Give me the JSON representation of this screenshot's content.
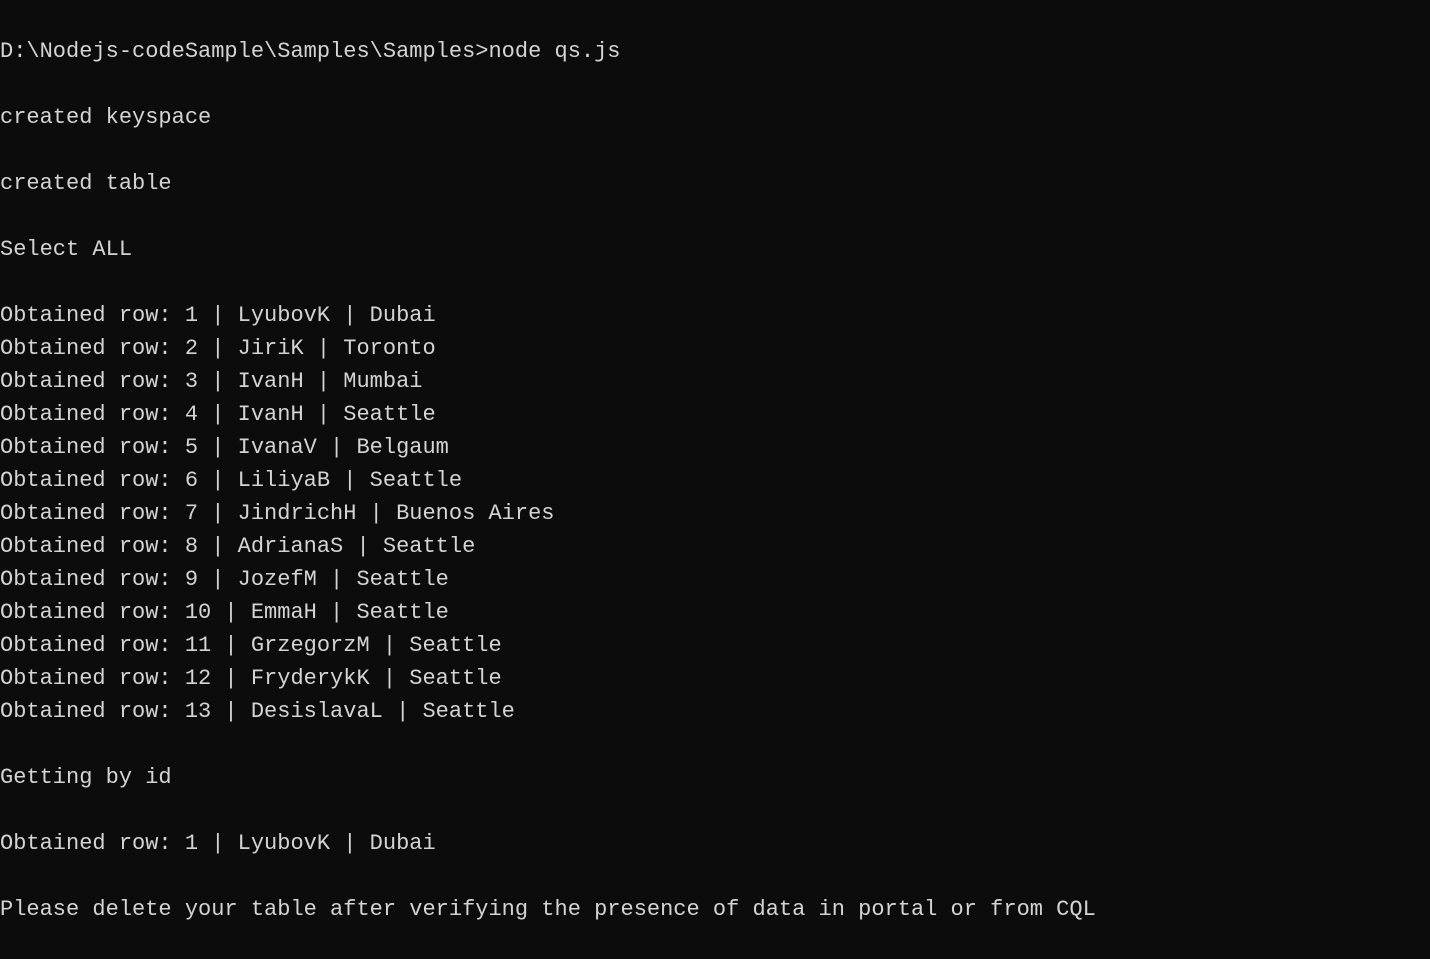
{
  "prompt": "D:\\Nodejs-codeSample\\Samples\\Samples>node qs.js",
  "lines": {
    "created_keyspace": "created keyspace",
    "created_table": "created table",
    "select_all": "Select ALL",
    "getting_by_id": "Getting by id",
    "final_message": "Please delete your table after verifying the presence of data in portal or from CQL"
  },
  "rows": [
    {
      "id": 1,
      "name": "LyubovK",
      "city": "Dubai"
    },
    {
      "id": 2,
      "name": "JiriK",
      "city": "Toronto"
    },
    {
      "id": 3,
      "name": "IvanH",
      "city": "Mumbai"
    },
    {
      "id": 4,
      "name": "IvanH",
      "city": "Seattle"
    },
    {
      "id": 5,
      "name": "IvanaV",
      "city": "Belgaum"
    },
    {
      "id": 6,
      "name": "LiliyaB",
      "city": "Seattle"
    },
    {
      "id": 7,
      "name": "JindrichH",
      "city": "Buenos Aires"
    },
    {
      "id": 8,
      "name": "AdrianaS",
      "city": "Seattle"
    },
    {
      "id": 9,
      "name": "JozefM",
      "city": "Seattle"
    },
    {
      "id": 10,
      "name": "EmmaH",
      "city": "Seattle"
    },
    {
      "id": 11,
      "name": "GrzegorzM",
      "city": "Seattle"
    },
    {
      "id": 12,
      "name": "FryderykK",
      "city": "Seattle"
    },
    {
      "id": 13,
      "name": "DesislavaL",
      "city": "Seattle"
    }
  ],
  "by_id_row": {
    "id": 1,
    "name": "LyubovK",
    "city": "Dubai"
  },
  "row_prefix": "Obtained row: "
}
